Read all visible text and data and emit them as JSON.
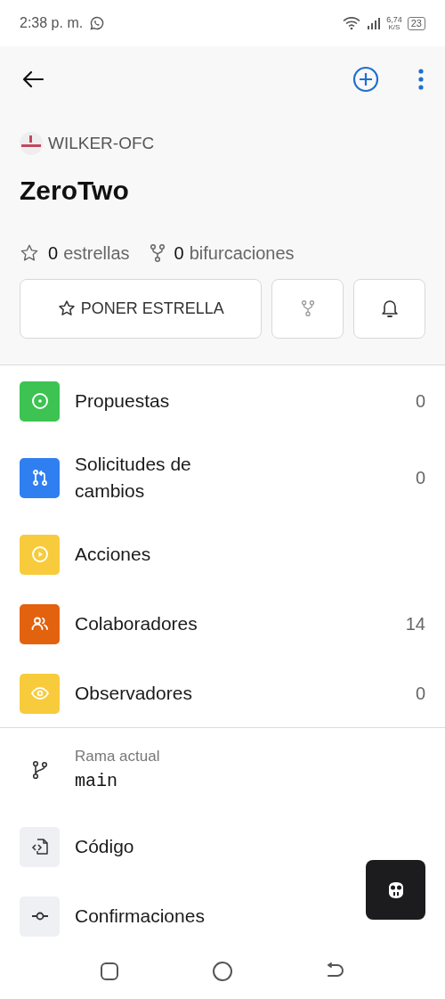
{
  "status_bar": {
    "time": "2:38 p. m.",
    "net_speed": "6,74",
    "net_unit": "K/S",
    "battery": "23"
  },
  "repo": {
    "owner": "WILKER-OFC",
    "name": "ZeroTwo",
    "stars_count": "0",
    "stars_label": "estrellas",
    "forks_count": "0",
    "forks_label": "bifurcaciones"
  },
  "star_button": "PONER ESTRELLA",
  "menu": [
    {
      "label": "Propuestas",
      "count": "0",
      "color": "#3cc352"
    },
    {
      "label": "Solicitudes de cambios",
      "count": "0",
      "color": "#2f7ff0"
    },
    {
      "label": "Acciones",
      "color": "#f8cb3c"
    },
    {
      "label": "Colaboradores",
      "count": "14",
      "color": "#e2620e"
    },
    {
      "label": "Observadores",
      "count": "0",
      "color": "#f8cb3c"
    }
  ],
  "branch": {
    "label": "Rama actual",
    "value": "main"
  },
  "links": [
    {
      "label": "Código"
    },
    {
      "label": "Confirmaciones"
    }
  ]
}
